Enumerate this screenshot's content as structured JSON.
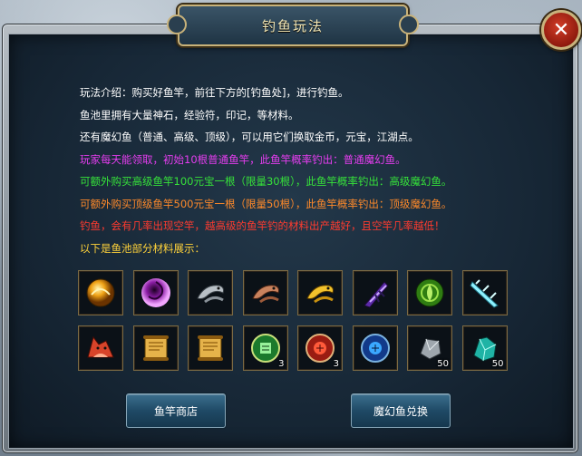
{
  "title": "钓鱼玩法",
  "close_icon": "close-x-icon",
  "description": [
    {
      "text": "玩法介绍：购买好鱼竿，前往下方的[钓鱼处]，进行钓鱼。",
      "color": "#ffffff"
    },
    {
      "text": "鱼池里拥有大量神石，经验符，印记，等材料。",
      "color": "#ffffff"
    },
    {
      "text": "还有魔幻鱼（普通、高级、顶级），可以用它们换取金币，元宝，江湖点。",
      "color": "#ffffff"
    },
    {
      "text": "玩家每天能领取，初始10根普通鱼竿，此鱼竿概率钓出：普通魔幻鱼。",
      "color": "#e63df0"
    },
    {
      "text": "可额外购买高级鱼竿100元宝一根（限量30根），此鱼竿概率钓出：高级魔幻鱼。",
      "color": "#36e23a"
    },
    {
      "text": "可额外购买顶级鱼竿500元宝一根（限量50根），此鱼竿概率钓出：顶级魔幻鱼。",
      "color": "#ff8a2a"
    },
    {
      "text": "钓鱼，会有几率出现空竿，越高级的鱼竿钓的材料出产越好，且空竿几率越低！",
      "color": "#ff3b2f"
    },
    {
      "text": "以下是鱼池部分材料展示：",
      "color": "#ffd23a"
    }
  ],
  "items": [
    {
      "icon": "gold-orb-icon",
      "count": ""
    },
    {
      "icon": "purple-vortex-orb-icon",
      "count": ""
    },
    {
      "icon": "silver-fish-icon",
      "count": ""
    },
    {
      "icon": "copper-fish-icon",
      "count": ""
    },
    {
      "icon": "gold-fish-icon",
      "count": ""
    },
    {
      "icon": "purple-claw-icon",
      "count": ""
    },
    {
      "icon": "green-rune-orb-icon",
      "count": ""
    },
    {
      "icon": "ice-blade-icon",
      "count": ""
    },
    {
      "icon": "red-fox-icon",
      "count": ""
    },
    {
      "icon": "scroll-icon",
      "count": ""
    },
    {
      "icon": "scroll-icon",
      "count": ""
    },
    {
      "icon": "green-seal-icon",
      "count": "3"
    },
    {
      "icon": "red-seal-icon",
      "count": "3"
    },
    {
      "icon": "blue-seal-icon",
      "count": ""
    },
    {
      "icon": "silver-stone-icon",
      "count": "50"
    },
    {
      "icon": "teal-crystal-icon",
      "count": "50"
    }
  ],
  "buttons": {
    "shop": "鱼竿商店",
    "exchange": "魔幻鱼兑换"
  }
}
